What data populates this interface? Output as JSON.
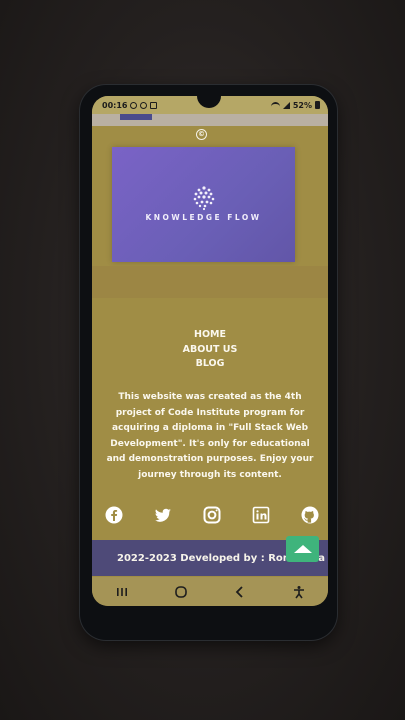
{
  "statusbar": {
    "time": "00:16",
    "battery": "52%"
  },
  "brand": {
    "logo_text": "KNOWLEDGE FLOW",
    "copyright_symbol": "©"
  },
  "nav": {
    "items": [
      {
        "label": "HOME"
      },
      {
        "label": "ABOUT US"
      },
      {
        "label": "BLOG"
      }
    ]
  },
  "about": {
    "text": "This website was created as the 4th project of Code Institute program for acquiring a diploma in \"Full Stack Web Development\". It's only for educational and demonstration purposes. Enjoy your journey through its content."
  },
  "socials": [
    {
      "icon": "facebook-icon"
    },
    {
      "icon": "twitter-icon"
    },
    {
      "icon": "instagram-icon"
    },
    {
      "icon": "linkedin-icon"
    },
    {
      "icon": "github-icon"
    }
  ],
  "footer": {
    "text": "2022-2023 Developed by : Roman Ra"
  },
  "colors": {
    "page_background": "#a08d45",
    "hero_purple": "#6a5fb6",
    "footer_band": "#4e4a78",
    "scroll_top_button": "#3fb47c",
    "text": "#fbf8ee"
  },
  "system_nav": {
    "recent_icon": "recents-icon",
    "home_icon": "home-circle-icon",
    "back_icon": "back-chevron-icon",
    "accessibility_icon": "accessibility-icon"
  }
}
